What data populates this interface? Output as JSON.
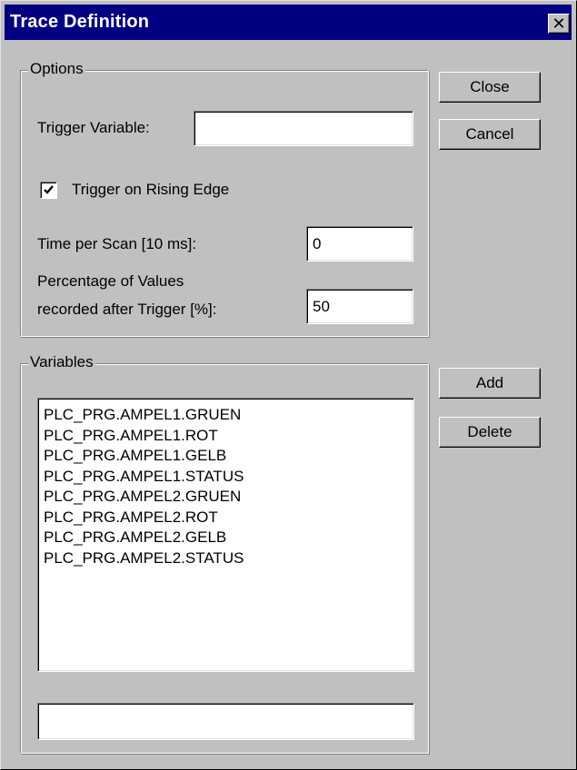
{
  "window": {
    "title": "Trace Definition",
    "close_glyph": "✕"
  },
  "options": {
    "group_label": "Options",
    "trigger_variable_label": "Trigger Variable:",
    "trigger_variable_value": "",
    "rising_edge_label": "Trigger on Rising Edge",
    "rising_edge_checked": true,
    "time_per_scan_label": "Time per Scan [10 ms]:",
    "time_per_scan_value": "0",
    "percentage_label_line1": "Percentage of Values",
    "percentage_label_line2": "recorded after Trigger [%]:",
    "percentage_value": "50"
  },
  "buttons": {
    "close": "Close",
    "cancel": "Cancel",
    "add": "Add",
    "delete": "Delete"
  },
  "variables": {
    "group_label": "Variables",
    "items": [
      "PLC_PRG.AMPEL1.GRUEN",
      "PLC_PRG.AMPEL1.ROT",
      "PLC_PRG.AMPEL1.GELB",
      "PLC_PRG.AMPEL1.STATUS",
      "PLC_PRG.AMPEL2.GRUEN",
      "PLC_PRG.AMPEL2.ROT",
      "PLC_PRG.AMPEL2.GELB",
      "PLC_PRG.AMPEL2.STATUS"
    ],
    "entry_value": ""
  }
}
